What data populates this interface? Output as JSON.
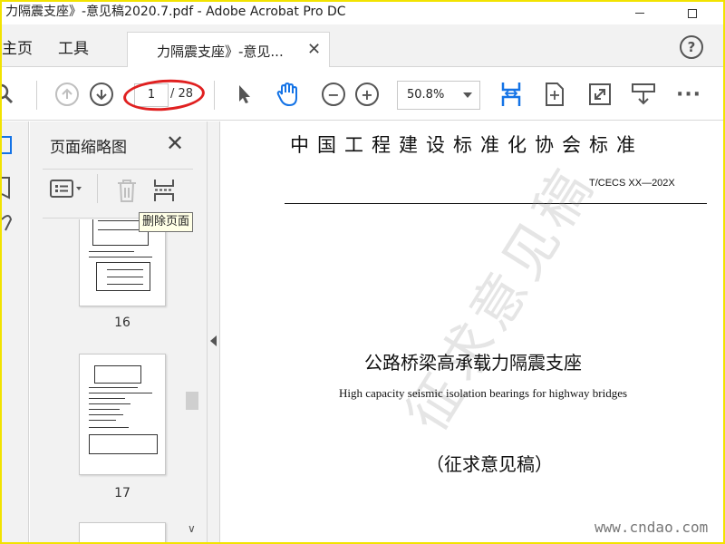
{
  "window": {
    "title": "力隔震支座》-意见稿2020.7.pdf - Adobe Acrobat Pro DC"
  },
  "menu": {
    "home_label": "主页",
    "tools_label": "工具",
    "tab_label": "力隔震支座》-意见...",
    "help_icon": "help-icon"
  },
  "toolbar": {
    "current_page": "1",
    "total_pages": "/ 28",
    "zoom": "50.8%"
  },
  "thumbnails": {
    "panel_title": "页面缩略图",
    "tooltip": "删除页面",
    "pages": [
      {
        "number": "16"
      },
      {
        "number": "17"
      }
    ]
  },
  "document": {
    "organization": "中国工程建设标准化协会标准",
    "standard_code": "T/CECS XX—202X",
    "title_cn": "公路桥梁高承载力隔震支座",
    "title_en": "High capacity seismic isolation bearings for highway bridges",
    "draft_label": "（征求意见稿）",
    "watermark": "征求意见稿",
    "site": "www.cndao.com"
  },
  "colors": {
    "accent": "#1473e6",
    "highlight_ring": "#e02020",
    "frame": "#f2e300"
  }
}
